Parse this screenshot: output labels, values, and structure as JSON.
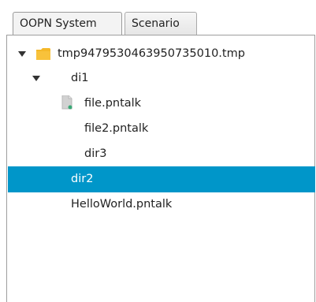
{
  "tabs": [
    {
      "label": "OOPN System"
    },
    {
      "label": "Scenario"
    }
  ],
  "tree": {
    "items": [
      {
        "label": "tmp947953046395073501​0.tmp"
      },
      {
        "label": "di1"
      },
      {
        "label": "file.pntalk"
      },
      {
        "label": "file2.pntalk"
      },
      {
        "label": "dir3"
      },
      {
        "label": "dir2"
      },
      {
        "label": "HelloWorld.pntalk"
      }
    ]
  },
  "colors": {
    "selection": "#0096c9",
    "folder": "#f5b829"
  },
  "icons": [
    "expand-arrow-icon",
    "folder-icon",
    "file-icon"
  ]
}
